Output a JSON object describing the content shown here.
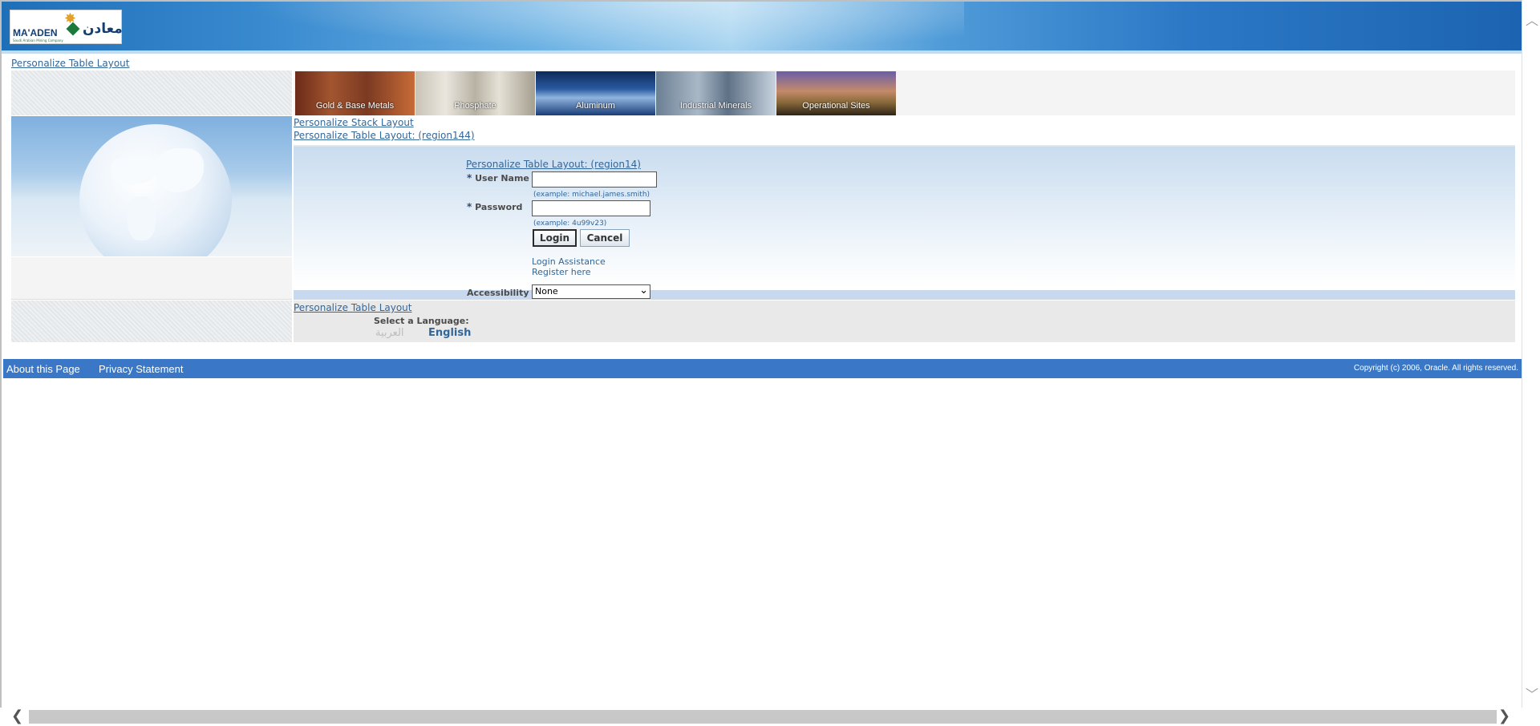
{
  "header": {
    "logo_en": "MA'ADEN",
    "logo_ar": "معادن",
    "logo_sub": "Saudi Arabian Mining Company"
  },
  "links": {
    "personalize_table_layout_top": "Personalize Table Layout",
    "personalize_stack_layout": "Personalize Stack Layout",
    "personalize_table_region144": "Personalize Table Layout: (region144)",
    "personalize_table_region14": "Personalize Table Layout: (region14)",
    "personalize_table_layout_bottom": "Personalize Table Layout"
  },
  "tabs": [
    {
      "label": "Gold & Base Metals"
    },
    {
      "label": "Phosphate"
    },
    {
      "label": "Aluminum"
    },
    {
      "label": "Industrial Minerals"
    },
    {
      "label": "Operational Sites"
    }
  ],
  "login": {
    "username_label": "User Name",
    "username_value": "",
    "username_hint": "(example: michael.james.smith)",
    "password_label": "Password",
    "password_value": "",
    "password_hint": "(example: 4u99v23)",
    "required_mark": "*",
    "login_button": "Login",
    "cancel_button": "Cancel",
    "login_assistance": "Login Assistance",
    "register_here": "Register here",
    "accessibility_label": "Accessibility",
    "accessibility_value": "None"
  },
  "language": {
    "select_label": "Select a Language:",
    "arabic": "العربية",
    "english": "English"
  },
  "footer": {
    "about": "About this Page",
    "privacy": "Privacy Statement",
    "copyright": "Copyright (c) 2006, Oracle. All rights reserved."
  },
  "colors": {
    "link": "#336699",
    "footer_bg": "#3a78c7"
  }
}
